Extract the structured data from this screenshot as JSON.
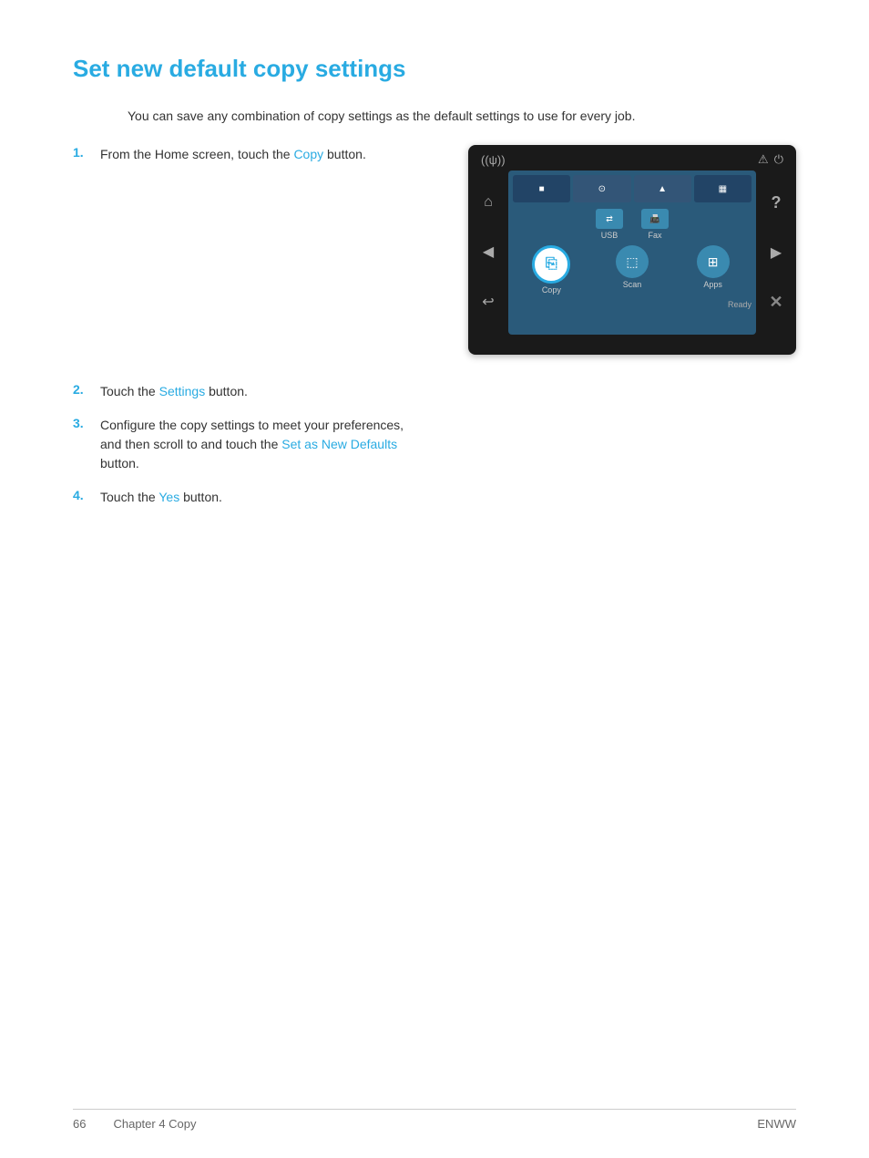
{
  "page": {
    "title": "Set new default copy settings",
    "intro": "You can save any combination of copy settings as the default settings to use for every job.",
    "steps": [
      {
        "number": "1.",
        "text_before": "From the Home screen, touch the ",
        "link_text": "Copy",
        "text_after": " button.",
        "has_image": true
      },
      {
        "number": "2.",
        "text_before": "Touch the ",
        "link_text": "Settings",
        "text_after": " button.",
        "has_image": false
      },
      {
        "number": "3.",
        "text_before": "Configure the copy settings to meet your preferences, and then scroll to and touch the ",
        "link_text": "Set as New Defaults",
        "text_after": " button.",
        "has_image": false
      },
      {
        "number": "4.",
        "text_before": "Touch the ",
        "link_text": "Yes",
        "text_after": " button.",
        "has_image": false
      }
    ],
    "screen": {
      "labels": {
        "usb": "USB",
        "fax": "Fax",
        "copy": "Copy",
        "scan": "Scan",
        "apps": "Apps",
        "ready": "Ready"
      }
    },
    "footer": {
      "page_number": "66",
      "chapter": "Chapter 4   Copy",
      "right_text": "ENWW"
    }
  }
}
